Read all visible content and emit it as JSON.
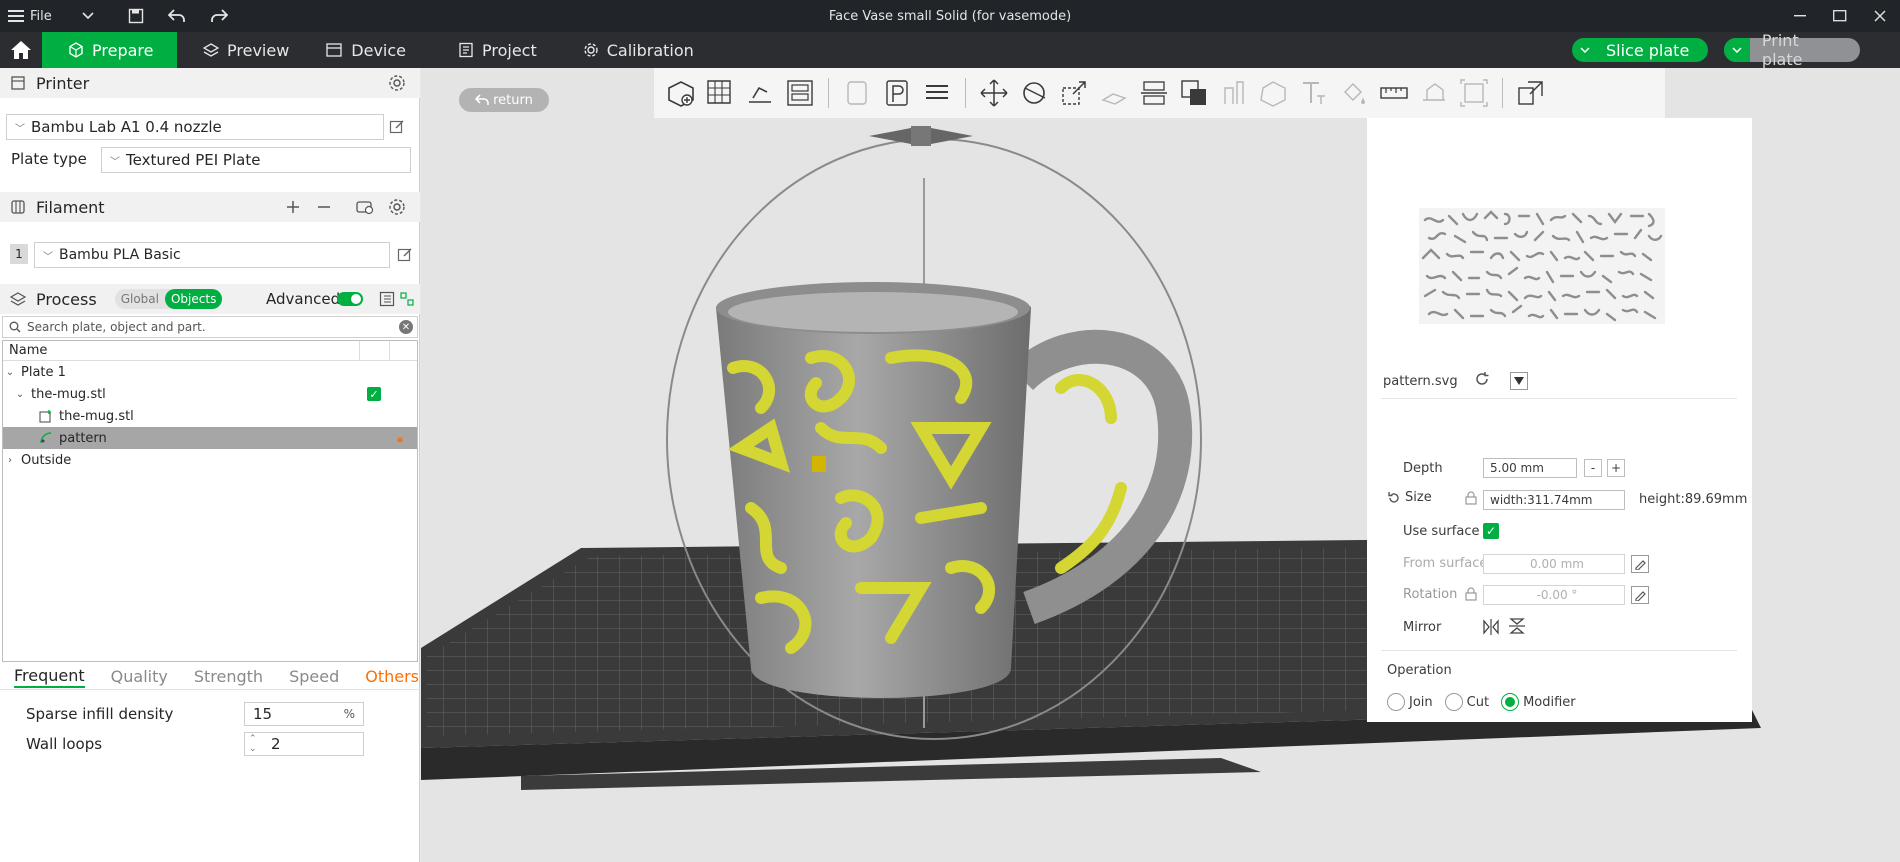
{
  "titlebar": {
    "menu_label": "File",
    "title": "Face Vase small Solid (for vasemode)"
  },
  "nav": {
    "tabs": [
      {
        "label": "Prepare"
      },
      {
        "label": "Preview"
      },
      {
        "label": "Device"
      },
      {
        "label": "Project"
      },
      {
        "label": "Calibration"
      }
    ],
    "slice_label": "Slice plate",
    "print_label": "Print plate"
  },
  "sidebar": {
    "printer_title": "Printer",
    "printer_value": "Bambu Lab A1 0.4 nozzle",
    "plate_type_label": "Plate type",
    "plate_type_value": "Textured PEI Plate",
    "filament_title": "Filament",
    "filament_index": "1",
    "filament_value": "Bambu PLA Basic",
    "process_title": "Process",
    "process_global": "Global",
    "process_objects": "Objects",
    "advanced_label": "Advanced",
    "search_placeholder": "Search plate, object and part.",
    "tree_header": "Name",
    "tree": {
      "plate": "Plate 1",
      "object": "the-mug.stl",
      "part": "the-mug.stl",
      "modifier": "pattern",
      "outside": "Outside"
    },
    "param_tabs": [
      "Frequent",
      "Quality",
      "Strength",
      "Speed",
      "Others"
    ],
    "params": {
      "infill_label": "Sparse infill density",
      "infill_value": "15",
      "infill_unit": "%",
      "walls_label": "Wall loops",
      "walls_value": "2"
    }
  },
  "viewport": {
    "return_label": "return"
  },
  "panel": {
    "file_name": "pattern.svg",
    "depth_label": "Depth",
    "depth_value": "5.00 mm",
    "minus": "-",
    "plus": "+",
    "size_label": "Size",
    "width_value": "width:311.74mm",
    "height_value": "height:89.69mm",
    "use_surface_label": "Use surface",
    "from_surface_label": "From surface",
    "from_surface_value": "0.00 mm",
    "rotation_label": "Rotation",
    "rotation_value": "-0.00 °",
    "mirror_label": "Mirror",
    "operation_label": "Operation",
    "op_join": "Join",
    "op_cut": "Cut",
    "op_modifier": "Modifier"
  },
  "colors": {
    "accent": "#00ae42",
    "pattern_yellow": "#d3d633",
    "annotation": "#e02020"
  }
}
